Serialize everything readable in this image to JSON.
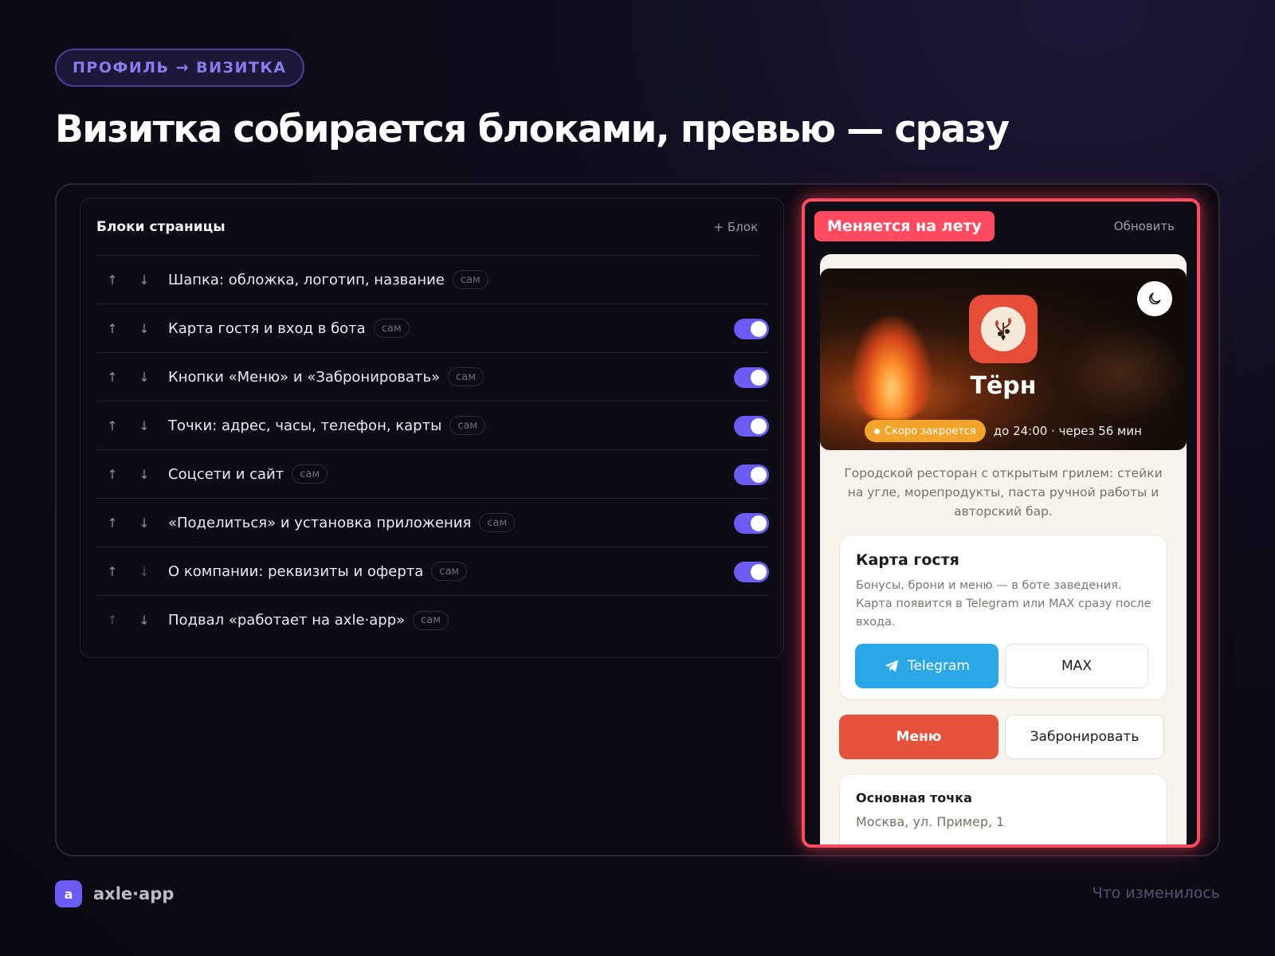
{
  "breadcrumb": "ПРОФИЛЬ → ВИЗИТКА",
  "headline": "Визитка собирается блоками, превью — сразу",
  "blocks": {
    "title": "Блоки страницы",
    "add_label": "+ Блок",
    "tag": "сам",
    "items": [
      {
        "label": "Шапка: обложка, логотип, название",
        "toggle": false,
        "up_dim": false,
        "down_dim": false
      },
      {
        "label": "Карта гостя и вход в бота",
        "toggle": true,
        "up_dim": false,
        "down_dim": false
      },
      {
        "label": "Кнопки «Меню» и «Забронировать»",
        "toggle": true,
        "up_dim": false,
        "down_dim": false
      },
      {
        "label": "Точки: адрес, часы, телефон, карты",
        "toggle": true,
        "up_dim": false,
        "down_dim": false
      },
      {
        "label": "Соцсети и сайт",
        "toggle": true,
        "up_dim": false,
        "down_dim": false
      },
      {
        "label": "«Поделиться» и установка приложения",
        "toggle": true,
        "up_dim": false,
        "down_dim": false
      },
      {
        "label": "О компании: реквизиты и оферта",
        "toggle": true,
        "up_dim": false,
        "down_dim": true
      },
      {
        "label": "Подвал «работает на axle·app»",
        "toggle": false,
        "up_dim": true,
        "down_dim": false
      }
    ]
  },
  "preview": {
    "badge": "Меняется на лету",
    "refresh": "Обновить",
    "venue_name": "Тёрн",
    "status_pill": "Скоро закроется",
    "status_text": "до 24:00 · через 56 мин",
    "description": "Городской ресторан с открытым грилем: стейки на угле, морепродукты, паста ручной работы и авторский бар.",
    "guest_card": {
      "title": "Карта гостя",
      "text": "Бонусы, брони и меню — в боте заведения. Карта появится в Telegram или MAX сразу после входа.",
      "telegram": "Telegram",
      "max": "MAX"
    },
    "menu_button": "Меню",
    "book_button": "Забронировать",
    "point": {
      "title": "Основная точка",
      "address": "Москва, ул. Пример, 1"
    }
  },
  "footer": {
    "logo_letter": "a",
    "brand": "axle·app",
    "right": "Что изменилось"
  },
  "colors": {
    "accent": "#6b5cf5",
    "live_badge": "#ff4a5f",
    "menu_button": "#e5533c",
    "telegram": "#2aa7e6",
    "status_pill": "#f2a52a"
  }
}
